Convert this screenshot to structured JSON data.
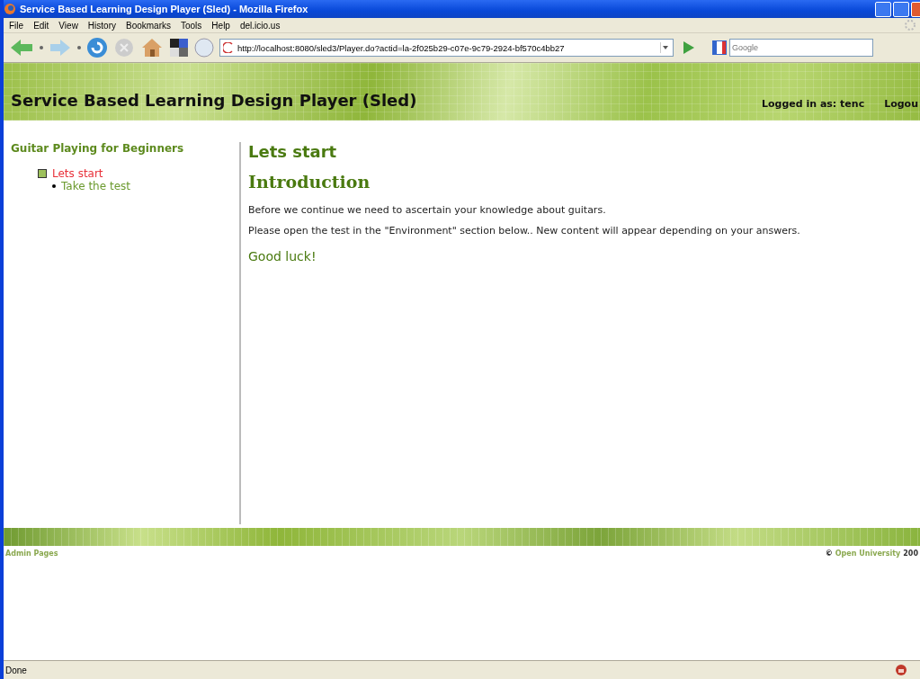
{
  "window": {
    "title": "Service Based Learning Design Player (Sled) - Mozilla Firefox"
  },
  "menu": [
    "File",
    "Edit",
    "View",
    "History",
    "Bookmarks",
    "Tools",
    "Help",
    "del.icio.us"
  ],
  "address": {
    "value": "http://localhost:8080/sled3/Player.do?actid=la-2f025b29-c07e-9c79-2924-bf570c4bb27"
  },
  "search": {
    "placeholder": "Google"
  },
  "header": {
    "title": "Service Based Learning Design Player (Sled)",
    "user": "Logged in as: tenc",
    "logout": "Logou"
  },
  "sidebar": {
    "title": "Guitar Playing for Beginners",
    "items": [
      {
        "label": "Lets start",
        "selected": true,
        "children": [
          {
            "label": "Take the test",
            "selected": false
          }
        ]
      }
    ]
  },
  "content": {
    "title": "Lets start",
    "heading": "Introduction",
    "paragraphs": [
      "Before we continue we need to ascertain your knowledge about guitars.",
      "Please open the test in the \"Environment\" section below.. New content will appear depending on your answers."
    ],
    "closing": "Good luck!"
  },
  "footer": {
    "admin": "Admin Pages",
    "copyright": "©",
    "org": "Open University",
    "year": "200"
  },
  "status_bar": {
    "text": "Done"
  }
}
